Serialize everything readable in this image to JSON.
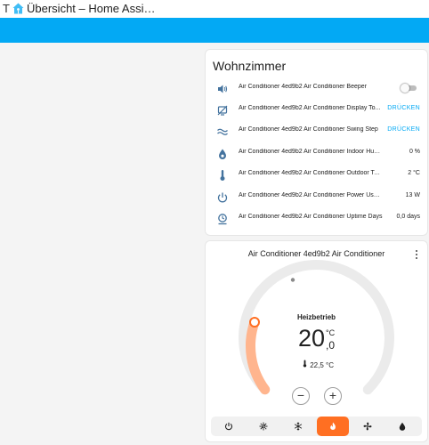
{
  "browser": {
    "tab_prefix": "T",
    "tab_title": "Übersicht – Home Assi…"
  },
  "entities_card": {
    "title": "Wohnzimmer",
    "rows": [
      {
        "name": "Air Conditioner 4ed9b2 Air Conditioner Beeper",
        "icon": "volume-icon",
        "type": "toggle",
        "state": "off"
      },
      {
        "name": "Air Conditioner 4ed9b2 Air Conditioner Display To...",
        "icon": "display-toggle-icon",
        "type": "button",
        "action": "DRÜCKEN"
      },
      {
        "name": "Air Conditioner 4ed9b2 Air Conditioner Swing Step",
        "icon": "swing-icon",
        "type": "button",
        "action": "DRÜCKEN"
      },
      {
        "name": "Air Conditioner 4ed9b2 Air Conditioner Indoor Humidity",
        "icon": "humidity-icon",
        "type": "value",
        "value": "0 %"
      },
      {
        "name": "Air Conditioner 4ed9b2 Air Conditioner Outdoor Temperat...",
        "icon": "thermometer-icon",
        "type": "value",
        "value": "2 °C"
      },
      {
        "name": "Air Conditioner 4ed9b2 Air Conditioner Power Usage",
        "icon": "power-icon",
        "type": "value",
        "value": "13 W"
      },
      {
        "name": "Air Conditioner 4ed9b2 Air Conditioner Uptime Days",
        "icon": "timer-icon",
        "type": "value",
        "value": "0,0 days"
      }
    ]
  },
  "thermostat": {
    "title": "Air Conditioner 4ed9b2 Air Conditioner",
    "mode_label": "Heizbetrieb",
    "target_whole": "20",
    "target_unit": "°C",
    "target_decimal": ",0",
    "current": "22,5 °C",
    "minus": "−",
    "plus": "+",
    "modes": [
      "off",
      "auto",
      "cool",
      "heat",
      "fan_only",
      "dry"
    ],
    "active_mode": "heat",
    "colors": {
      "heat": "#ff6f22",
      "arc_track": "#ebebeb",
      "arc_fill": "#ffb58e"
    }
  }
}
